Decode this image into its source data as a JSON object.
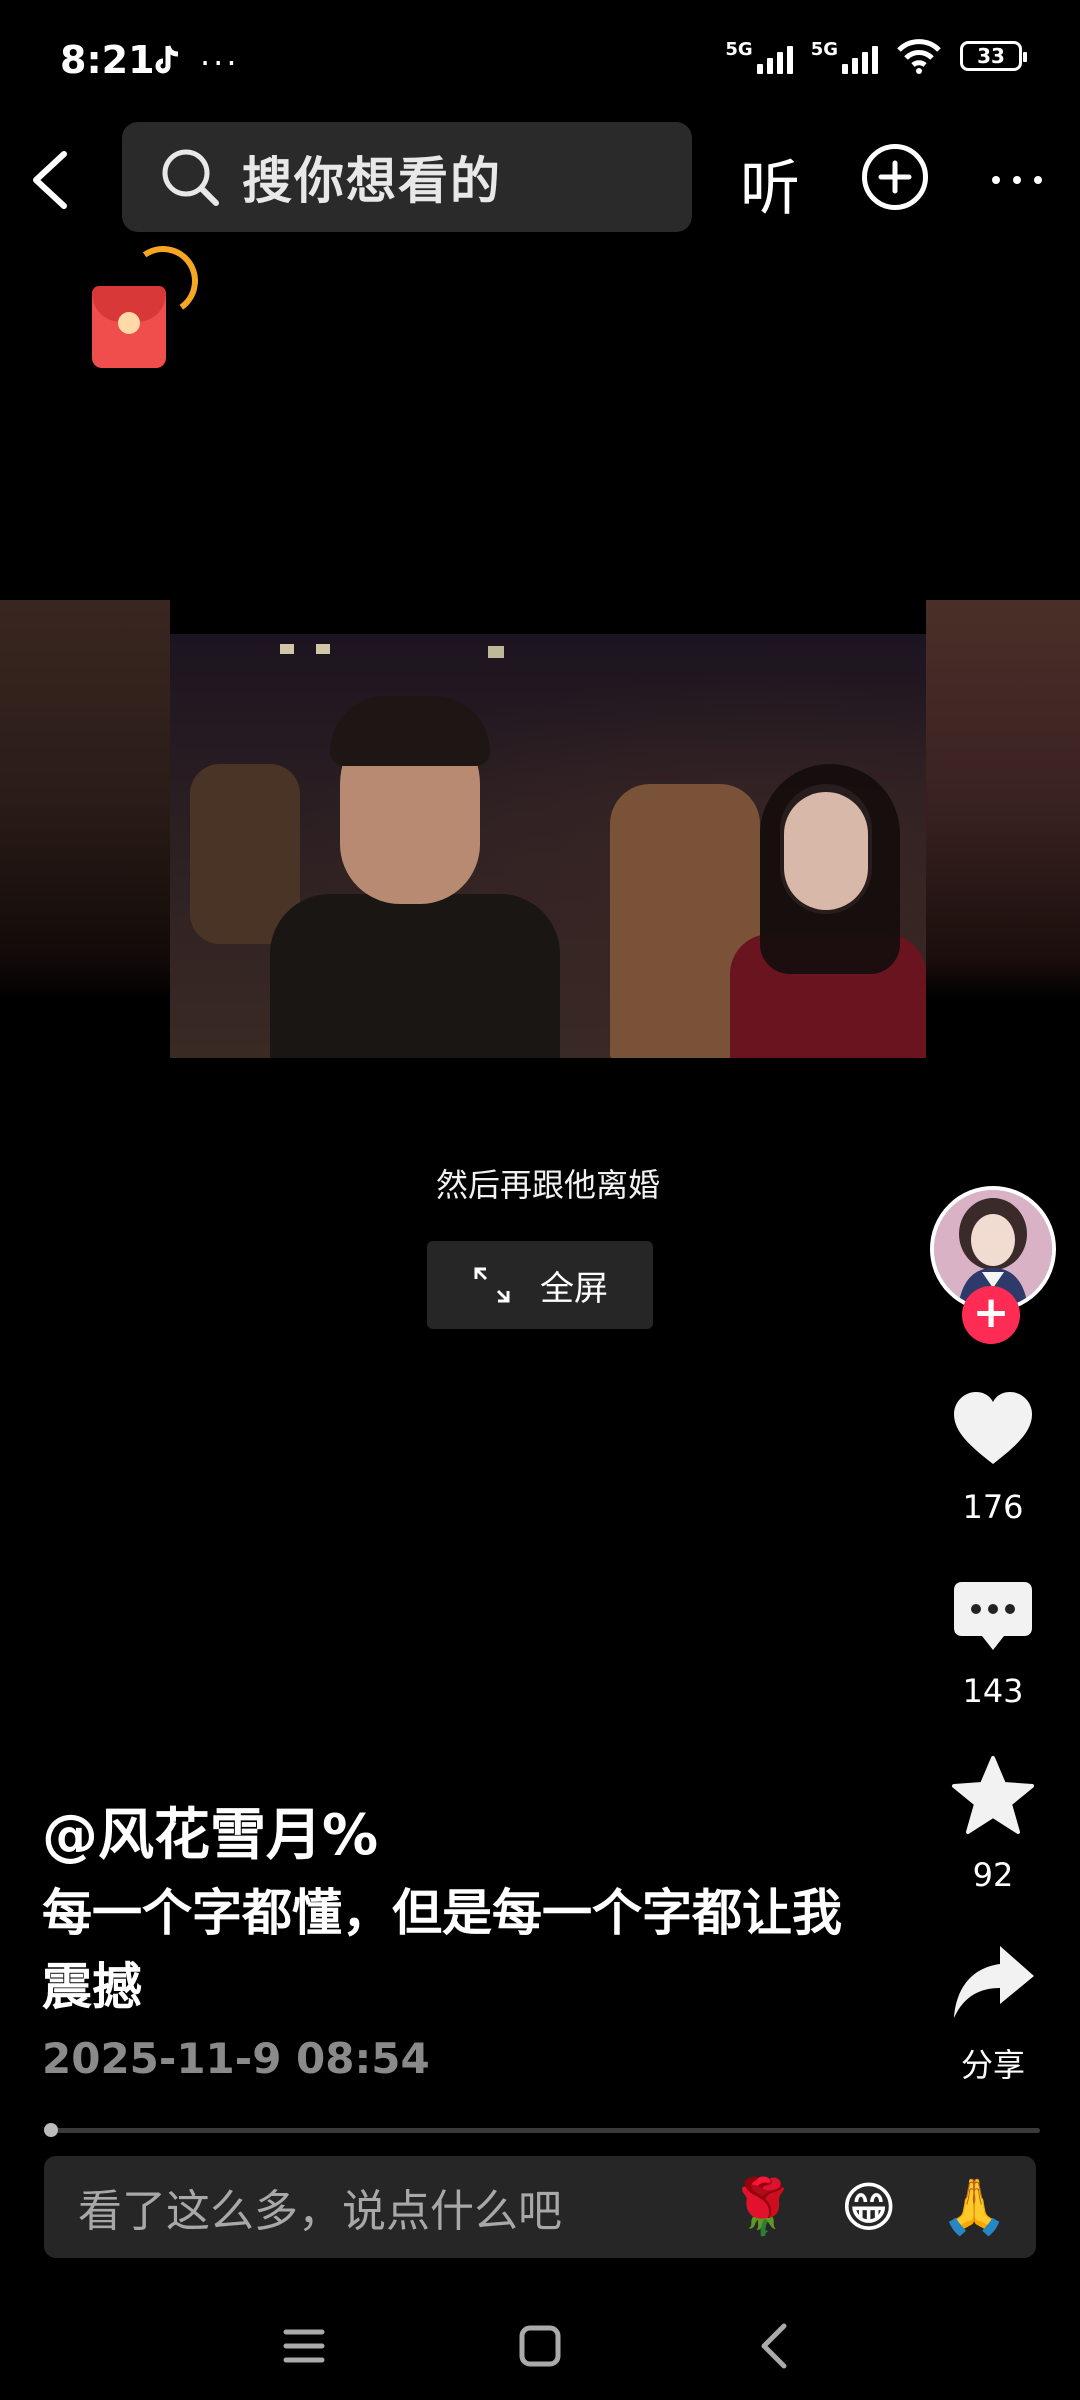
{
  "status_bar": {
    "time": "8:21",
    "signal1": "5G",
    "signal2": "5G",
    "battery": "33"
  },
  "top_bar": {
    "search_placeholder": "搜你想看的",
    "listen_label": "听"
  },
  "video": {
    "caption": "然后再跟他离婚",
    "fullscreen_label": "全屏"
  },
  "actions": {
    "follow_symbol": "+",
    "like_count": "176",
    "comment_count": "143",
    "favorite_count": "92",
    "share_label": "分享"
  },
  "post": {
    "author": "@风花雪月%",
    "description": "每一个字都懂，但是每一个字都让我震撼",
    "timestamp": "2025-11-9 08:54"
  },
  "comment_input": {
    "placeholder": "看了这么多，说点什么吧",
    "emojis": [
      "🌹",
      "😁",
      "🙏"
    ]
  },
  "colors": {
    "accent": "#fe2c55",
    "background": "#000000",
    "search_bg": "#2a2a2a"
  },
  "icons": [
    "back-icon",
    "search-icon",
    "add-icon",
    "more-icon",
    "red-packet-icon",
    "fullscreen-icon",
    "heart-icon",
    "comment-icon",
    "star-icon",
    "share-icon",
    "menu-icon",
    "home-icon",
    "nav-back-icon"
  ]
}
